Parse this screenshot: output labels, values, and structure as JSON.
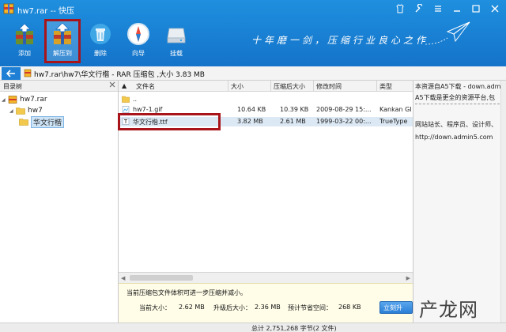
{
  "window": {
    "title": "hw7.rar -- 快压"
  },
  "toolbar": {
    "items": [
      {
        "label": "添加"
      },
      {
        "label": "解压到"
      },
      {
        "label": "删除"
      },
      {
        "label": "向导"
      },
      {
        "label": "挂载"
      }
    ],
    "slogan": "十年磨一剑，压缩行业良心之作"
  },
  "address": {
    "path": "hw7.rar\\hw7\\华文行楷 - RAR 压缩包 ,大小 3.83 MB"
  },
  "tree": {
    "header": "目录树",
    "nodes": [
      {
        "label": "hw7.rar"
      },
      {
        "label": "hw7"
      },
      {
        "label": "华文行楷"
      }
    ]
  },
  "file_list": {
    "columns": [
      "文件名",
      "大小",
      "压缩后大小",
      "修改时间",
      "类型"
    ],
    "rows": [
      {
        "name": "..",
        "size": "",
        "packed": "",
        "modified": "",
        "type": ""
      },
      {
        "name": "hw7-1.gif",
        "size": "10.64 KB",
        "packed": "10.39 KB",
        "modified": "2009-08-29  15:...",
        "type": "Kankan GI"
      },
      {
        "name": "华文行楷.ttf",
        "size": "3.82 MB",
        "packed": "2.61 MB",
        "modified": "1999-03-22  00:...",
        "type": "TrueType"
      }
    ]
  },
  "info_panel": {
    "lines": [
      "本资源自A5下载 - down.admi",
      "A5下载是更全的资源平台,包",
      "网站站长、程序员、设计师、",
      "http://down.admin5.com"
    ]
  },
  "tip": {
    "message": "当前压缩包文件体积可进一步压缩并减小。",
    "current_label": "当前大小：",
    "current_value": "2.62 MB",
    "upgraded_label": "升级后大小：",
    "upgraded_value": "2.36 MB",
    "saved_label": "预计节省空间：",
    "saved_value": "268 KB",
    "button_label": "立刻升"
  },
  "status": {
    "text": "总计 2,751,268 字节(2 文件)"
  },
  "watermark": {
    "text": "产龙网"
  },
  "colors": {
    "toolbar_blue": "#1a82d4",
    "highlight_red": "#a8141a",
    "tip_bg": "#fffde8"
  }
}
